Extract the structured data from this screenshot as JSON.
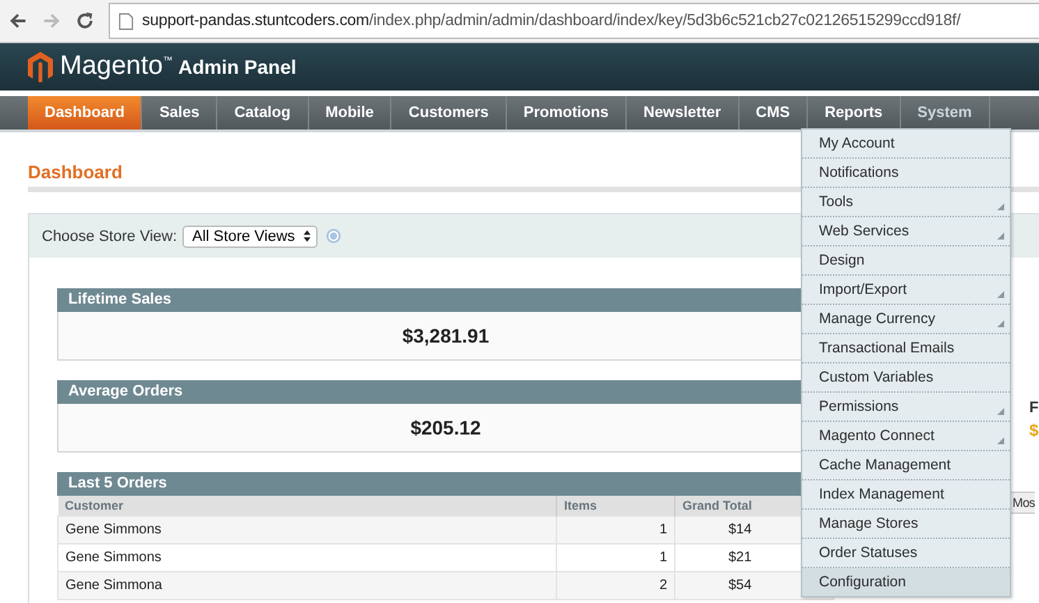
{
  "browser": {
    "url_host": "support-pandas.stuntcoders.com",
    "url_path": "/index.php/admin/admin/dashboard/index/key/5d3b6c521cb27c02126515299ccd918f/"
  },
  "header": {
    "brand": "Magento$^{™}$",
    "subtitle": "Admin Panel"
  },
  "nav": [
    {
      "label": "Dashboard",
      "selected": true,
      "open": false
    },
    {
      "label": "Sales",
      "selected": false,
      "open": false
    },
    {
      "label": "Catalog",
      "selected": false,
      "open": false
    },
    {
      "label": "Mobile",
      "selected": false,
      "open": false
    },
    {
      "label": "Customers",
      "selected": false,
      "open": false
    },
    {
      "label": "Promotions",
      "selected": false,
      "open": false
    },
    {
      "label": "Newsletter",
      "selected": false,
      "open": false
    },
    {
      "label": "CMS",
      "selected": false,
      "open": false
    },
    {
      "label": "Reports",
      "selected": false,
      "open": false
    },
    {
      "label": "System",
      "selected": false,
      "open": true
    }
  ],
  "system_menu": [
    {
      "label": "My Account",
      "submenu": false,
      "selected": false
    },
    {
      "label": "Notifications",
      "submenu": false,
      "selected": false
    },
    {
      "label": "Tools",
      "submenu": true,
      "selected": false
    },
    {
      "label": "Web Services",
      "submenu": true,
      "selected": false
    },
    {
      "label": "Design",
      "submenu": false,
      "selected": false
    },
    {
      "label": "Import/Export",
      "submenu": true,
      "selected": false
    },
    {
      "label": "Manage Currency",
      "submenu": true,
      "selected": false
    },
    {
      "label": "Transactional Emails",
      "submenu": false,
      "selected": false
    },
    {
      "label": "Custom Variables",
      "submenu": false,
      "selected": false
    },
    {
      "label": "Permissions",
      "submenu": true,
      "selected": false
    },
    {
      "label": "Magento Connect",
      "submenu": true,
      "selected": false
    },
    {
      "label": "Cache Management",
      "submenu": false,
      "selected": false
    },
    {
      "label": "Index Management",
      "submenu": false,
      "selected": false
    },
    {
      "label": "Manage Stores",
      "submenu": false,
      "selected": false
    },
    {
      "label": "Order Statuses",
      "submenu": false,
      "selected": false
    },
    {
      "label": "Configuration",
      "submenu": false,
      "selected": true
    }
  ],
  "page_title": "Dashboard",
  "store_switcher": {
    "label": "Choose Store View:",
    "value": "All Store Views"
  },
  "stats": [
    {
      "title": "Lifetime Sales",
      "value": "$3,281.91"
    },
    {
      "title": "Average Orders",
      "value": "$205.12"
    }
  ],
  "orders": {
    "title": "Last 5 Orders",
    "columns": [
      "Customer",
      "Items",
      "Grand Total"
    ],
    "rows": [
      {
        "customer": "Gene Simmons",
        "items": "1",
        "grand_total": "$14"
      },
      {
        "customer": "Gene Simmons",
        "items": "1",
        "grand_total": "$21"
      },
      {
        "customer": "Gene Simmona",
        "items": "2",
        "grand_total": "$54"
      }
    ]
  },
  "right_panel": {
    "title": "F",
    "value": "$",
    "tab": "Mos"
  }
}
